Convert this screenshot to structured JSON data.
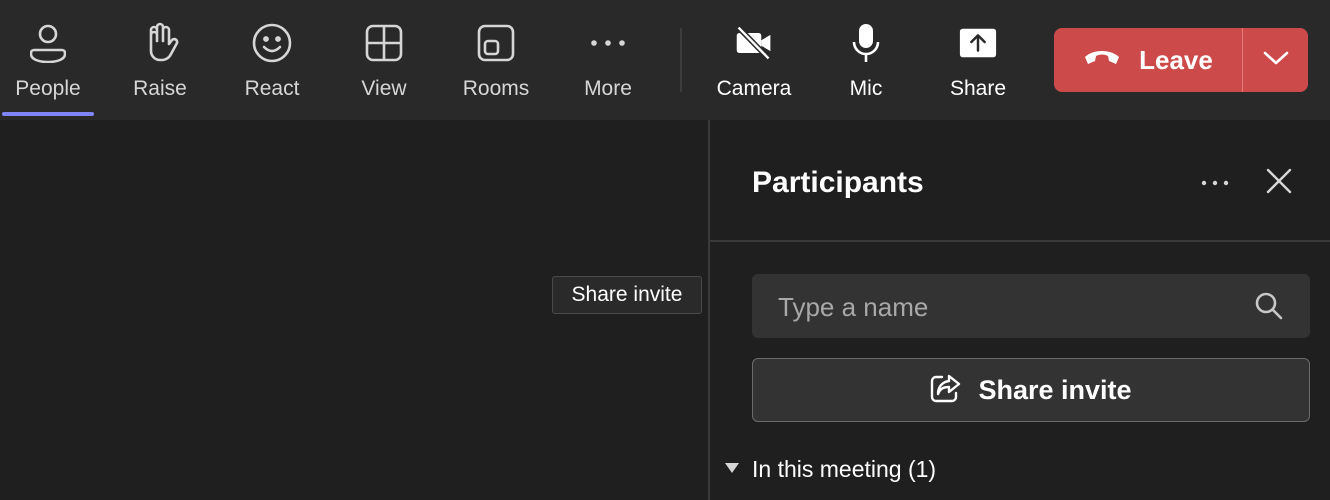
{
  "toolbar": {
    "items": [
      {
        "label": "People",
        "icon": "person-icon"
      },
      {
        "label": "Raise",
        "icon": "hand-icon"
      },
      {
        "label": "React",
        "icon": "smiley-icon"
      },
      {
        "label": "View",
        "icon": "grid-icon"
      },
      {
        "label": "Rooms",
        "icon": "rooms-icon"
      },
      {
        "label": "More",
        "icon": "more-icon"
      },
      {
        "label": "Camera",
        "icon": "camera-off-icon"
      },
      {
        "label": "Mic",
        "icon": "mic-icon"
      },
      {
        "label": "Share",
        "icon": "share-icon"
      }
    ],
    "leave": {
      "label": "Leave"
    }
  },
  "panel": {
    "title": "Participants",
    "search": {
      "placeholder": "Type a name",
      "value": ""
    },
    "share_invite": "Share invite",
    "section": {
      "label": "In this meeting (1)"
    }
  },
  "tooltip": "Share invite",
  "colors": {
    "accent": "#7f85f5",
    "leave": "#cc4a4a",
    "background": "#1f1f1f",
    "toolbar": "#292929"
  }
}
